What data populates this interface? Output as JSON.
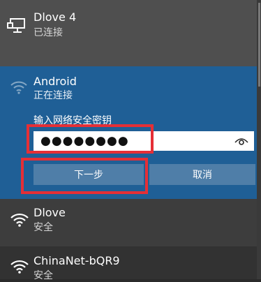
{
  "networks": {
    "dlove4": {
      "name": "Dlove 4",
      "status": "已连接",
      "icon": "ethernet-icon"
    },
    "android": {
      "name": "Android",
      "status": "正在连接",
      "icon": "wifi-icon",
      "password_prompt": "输入网络安全密钥",
      "password_value": "●●●●●●●●",
      "show_password_icon": "eye-icon",
      "next_button": "下一步",
      "cancel_button": "取消"
    },
    "dlove": {
      "name": "Dlove",
      "status": "安全",
      "icon": "wifi-icon"
    },
    "chinanet": {
      "name": "ChinaNet-bQR9",
      "status": "安全",
      "icon": "wifi-icon"
    }
  },
  "colors": {
    "selected_bg": "#1f5f96",
    "highlight": "#e52f36",
    "button_bg": "#4f7ea8"
  }
}
